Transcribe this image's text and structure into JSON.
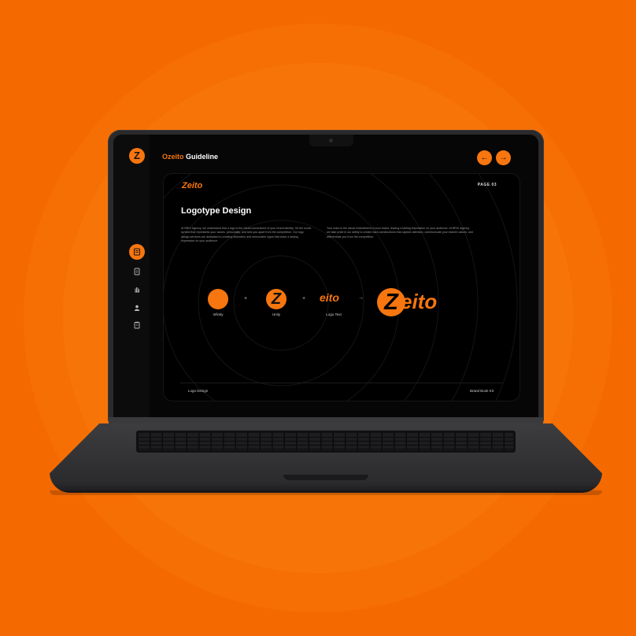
{
  "app": {
    "title_accent": "Ozeito",
    "title_rest": "Guideline",
    "logo_letter": "Z"
  },
  "nav": {
    "prev_symbol": "←",
    "next_symbol": "→"
  },
  "sidebar": {
    "items": [
      {
        "icon": "book-icon",
        "active": true
      },
      {
        "icon": "document-icon",
        "active": false
      },
      {
        "icon": "hand-icon",
        "active": false
      },
      {
        "icon": "user-icon",
        "active": false
      },
      {
        "icon": "clipboard-icon",
        "active": false
      }
    ]
  },
  "page": {
    "logo_text": "Zeito",
    "page_number": "PAGE 03",
    "heading": "Logotype Design",
    "para_left": "At BRIX Agency, we understand that a logo is the visual cornerstone of your brand identity. It's the iconic symbol that represents your values, personality, and sets you apart from the competition. Our logo design services are dedicated to creating distinctive and memorable logos that leave a lasting impression on your audience.",
    "para_right": "Your mark is the visual embodiment of your brand, leaving a lasting impression on your audience. At BRIX Agency, we take pride in our ability to create mark constructions that capture attention, communicate your brand's values, and differentiate you from the competition.",
    "steps": [
      {
        "label": "Infinity"
      },
      {
        "label": "Unity",
        "glyph": "Z"
      },
      {
        "label": "Logo Text",
        "text": "eito"
      }
    ],
    "operators": [
      "+",
      "+",
      "→"
    ],
    "final_logo": {
      "glyph": "Z",
      "text": "eito"
    },
    "footer_left": "Logo Design",
    "footer_right": "Brand Book Kit"
  },
  "colors": {
    "background": "#f56a00",
    "accent": "#f7760f",
    "screen": "#000000"
  }
}
